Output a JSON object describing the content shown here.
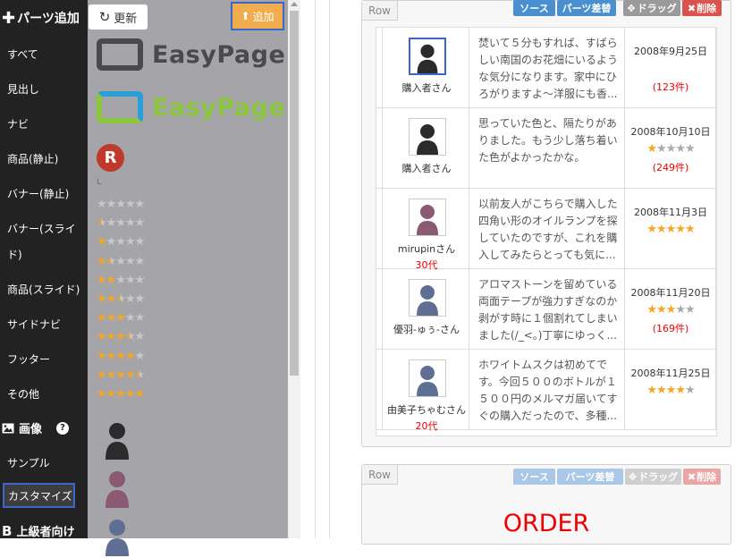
{
  "nav": {
    "header": "パーツ追加",
    "items": [
      "すべて",
      "見出し",
      "ナビ",
      "商品(静止)",
      "バナー(静止)",
      "バナー(スライ",
      "ド)",
      "商品(スライド)",
      "サイドナビ",
      "フッター",
      "その他"
    ],
    "image_section": "画像",
    "image_help": "?",
    "sample": "サンプル",
    "customize": "カスタマイズ",
    "advanced": "上級者向け"
  },
  "palette": {
    "refresh_label": "更新",
    "add_label": "追加",
    "logo_text": "EasyPage",
    "badge_letter": "R",
    "tiny_mark": "L",
    "star_ratings": [
      0,
      0.5,
      1,
      1.5,
      2,
      2.5,
      3,
      3.5,
      4,
      4.5,
      5
    ]
  },
  "row1": {
    "tag": "Row",
    "toolbar": {
      "source": "ソース",
      "swap": "パーツ差替",
      "drag": "ドラッグ",
      "delete": "削除"
    }
  },
  "reviews": [
    {
      "name": "購入者さん",
      "age": "",
      "text": "焚いて５分もすれば、すばらしい南国のお花畑にいるような気分になります。家中にひろがりますよ〜洋服にも香...",
      "date": "2008年9月25日",
      "rating": 0,
      "count": "(123件)",
      "avatar_color": "#2b2b2b",
      "selected": true
    },
    {
      "name": "購入者さん",
      "age": "",
      "text": "思っていた色と、隔たりがありました。もう少し落ち着いた色がよかったかな。",
      "date": "2008年10月10日",
      "rating": 1,
      "count": "(249件)",
      "avatar_color": "#2b2b2b",
      "selected": false
    },
    {
      "name": "mirupinさん",
      "age": "30代",
      "text": "以前友人がこちらで購入した四角い形のオイルランプを探していたのですが、これを購入してみたらとっても気に...",
      "date": "2008年11月3日",
      "rating": 5,
      "count": "",
      "avatar_color": "#8a5a72",
      "selected": false
    },
    {
      "name": "優羽-ゅぅ-さん",
      "age": "",
      "text": "アロマストーンを留めている両面テープが強力すぎなのか剥がす時に１個割れてしまいました(/_<。)丁寧にゆっく...",
      "date": "2008年11月20日",
      "rating": 3,
      "count": "(169件)",
      "avatar_color": "#5f6f93",
      "selected": false
    },
    {
      "name": "由美子ちゃむさん",
      "age": "20代",
      "text": "ホワイトムスクは初めてです。今回５００のボトルが１５００円のメルマガ届いてすぐの購入だったので、多種...",
      "date": "2008年11月25日",
      "rating": 4,
      "count": "",
      "avatar_color": "#5f6f93",
      "selected": false
    }
  ],
  "row2": {
    "tag": "Row",
    "toolbar": {
      "source": "ソース",
      "swap": "パーツ差替",
      "drag": "ドラッグ",
      "delete": "削除"
    },
    "order_text": "ORDER"
  }
}
